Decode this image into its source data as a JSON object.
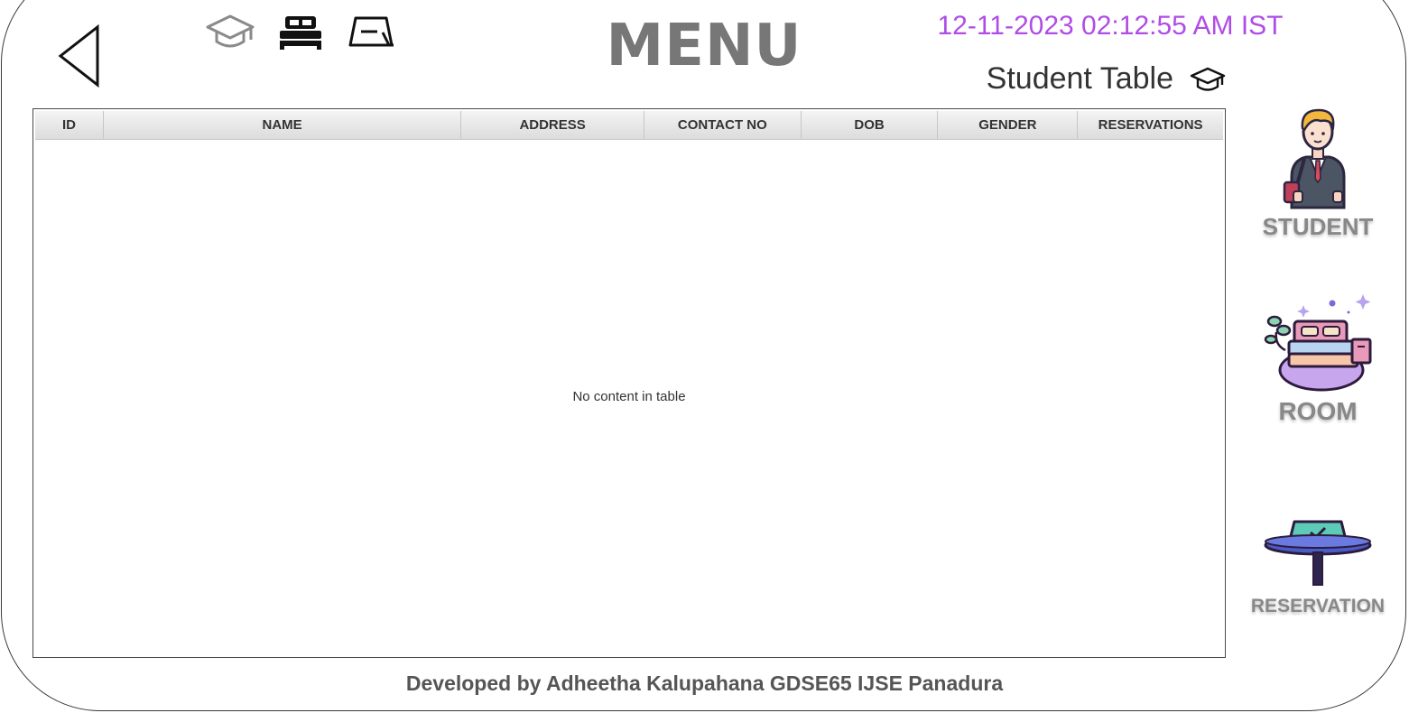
{
  "header": {
    "title": "MENU",
    "datetime": "12-11-2023 02:12:55 AM IST",
    "table_title": "Student Table"
  },
  "top_icons": [
    {
      "name": "graduation-cap-icon"
    },
    {
      "name": "bed-icon"
    },
    {
      "name": "reservation-sign-icon"
    }
  ],
  "table": {
    "columns": [
      "ID",
      "NAME",
      "ADDRESS",
      "CONTACT NO",
      "DOB",
      "GENDER",
      "RESERVATIONS"
    ],
    "rows": [],
    "empty_message": "No content in table"
  },
  "side_nav": {
    "student_label": "STUDENT",
    "room_label": "ROOM",
    "reservation_label": "RESERVATION"
  },
  "footer": {
    "text": "Developed by Adheetha Kalupahana GDSE65 IJSE Panadura"
  },
  "colors": {
    "datetime": "#b04ce6",
    "title": "#777777",
    "label": "#888888"
  }
}
